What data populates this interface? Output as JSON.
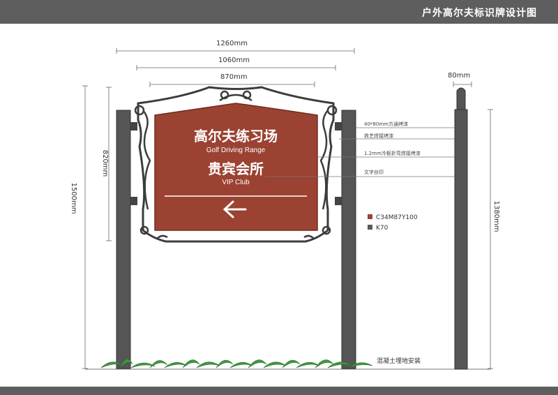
{
  "header": {
    "title": "户外高尔夫标识牌设计图"
  },
  "dimensions": {
    "width_total": "1260mm",
    "width_mid": "1060mm",
    "width_panel": "870mm",
    "width_post": "80mm",
    "height_panel": "820mm",
    "height_total": "1500mm",
    "height_post": "1380mm"
  },
  "sign": {
    "title_cn": "高尔夫练习场",
    "title_en": "Golf Driving Range",
    "subtitle_cn": "贵宾会所",
    "subtitle_en": "VIP Club",
    "arrow": "left-arrow-icon"
  },
  "notes": [
    "40*80mm方通烤漆",
    "铁艺焊接烤漆",
    "1.2mm冷板折弯焊接烤漆",
    "文字丝印"
  ],
  "legend": [
    {
      "label": "C34M87Y100",
      "color": "#9b4232"
    },
    {
      "label": "K70",
      "color": "#595959"
    }
  ],
  "footer": {
    "install_note": "混凝土埋地安装"
  },
  "colors": {
    "panel": "#9b4232",
    "post": "#555555",
    "frame": "#3c3c3c",
    "plant": "#3f9a3f"
  }
}
